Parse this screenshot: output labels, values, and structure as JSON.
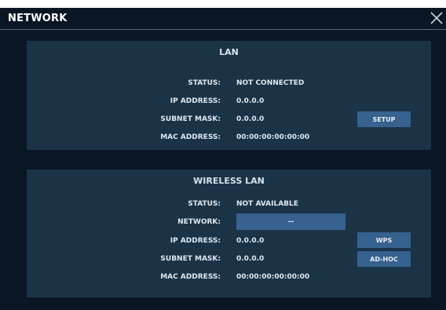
{
  "window": {
    "title": "NETWORK",
    "close_icon": "close-icon"
  },
  "lan": {
    "title": "LAN",
    "rows": [
      {
        "label": "STATUS:",
        "value": "NOT CONNECTED"
      },
      {
        "label": "IP ADDRESS:",
        "value": "0.0.0.0"
      },
      {
        "label": "SUBNET MASK:",
        "value": "0.0.0.0"
      },
      {
        "label": "MAC ADDRESS:",
        "value": "00:00:00:00:00:00"
      }
    ],
    "setup_label": "SETUP"
  },
  "wlan": {
    "title": "WIRELESS LAN",
    "status_label": "STATUS:",
    "status_value": "NOT AVAILABLE",
    "network_label": "NETWORK:",
    "network_value": "--",
    "rows": [
      {
        "label": "IP ADDRESS:",
        "value": "0.0.0.0"
      },
      {
        "label": "SUBNET MASK:",
        "value": "0.0.0.0"
      },
      {
        "label": "MAC ADDRESS:",
        "value": "00:00:00:00:00:00"
      }
    ],
    "wps_label": "WPS",
    "adhoc_label": "AD-HOC"
  },
  "colors": {
    "background": "#0a1624",
    "panel": "#1b3347",
    "button": "#37618e",
    "text": "#dfe8f0"
  }
}
